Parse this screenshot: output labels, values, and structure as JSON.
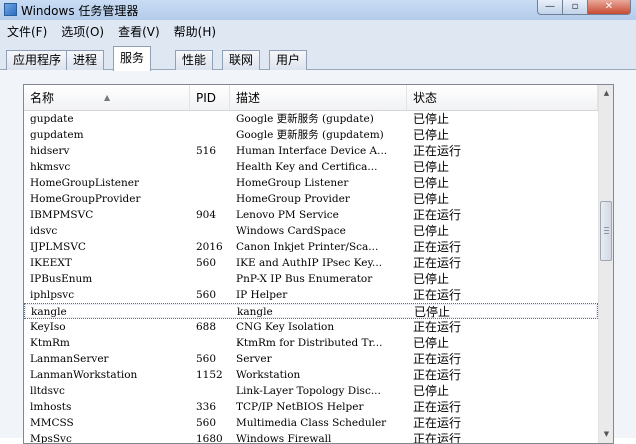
{
  "window": {
    "title": "Windows 任务管理器",
    "controls": {
      "minimize": "—",
      "maximize": "▫",
      "close": "✕"
    }
  },
  "menu": [
    "文件(F)",
    "选项(O)",
    "查看(V)",
    "帮助(H)"
  ],
  "tabs": [
    {
      "label": "应用程序",
      "active": false
    },
    {
      "label": "进程",
      "active": false
    },
    {
      "label": "服务",
      "active": true
    },
    {
      "label": "性能",
      "active": false
    },
    {
      "label": "联网",
      "active": false
    },
    {
      "label": "用户",
      "active": false
    }
  ],
  "services": {
    "columns": {
      "name": "名称",
      "pid": "PID",
      "desc": "描述",
      "status": "状态"
    },
    "sort": {
      "column": "name",
      "direction": "ascending"
    },
    "rows": [
      {
        "name": "gupdate",
        "pid": "",
        "desc": "Google 更新服务 (gupdate)",
        "status": "已停止",
        "selected": false
      },
      {
        "name": "gupdatem",
        "pid": "",
        "desc": "Google 更新服务 (gupdatem)",
        "status": "已停止",
        "selected": false
      },
      {
        "name": "hidserv",
        "pid": "516",
        "desc": "Human Interface Device A...",
        "status": "正在运行",
        "selected": false
      },
      {
        "name": "hkmsvc",
        "pid": "",
        "desc": "Health Key and Certifica...",
        "status": "已停止",
        "selected": false
      },
      {
        "name": "HomeGroupListener",
        "pid": "",
        "desc": "HomeGroup Listener",
        "status": "已停止",
        "selected": false
      },
      {
        "name": "HomeGroupProvider",
        "pid": "",
        "desc": "HomeGroup Provider",
        "status": "已停止",
        "selected": false
      },
      {
        "name": "IBMPMSVC",
        "pid": "904",
        "desc": "Lenovo PM Service",
        "status": "正在运行",
        "selected": false
      },
      {
        "name": "idsvc",
        "pid": "",
        "desc": "Windows CardSpace",
        "status": "已停止",
        "selected": false
      },
      {
        "name": "IJPLMSVC",
        "pid": "2016",
        "desc": "Canon Inkjet Printer/Sca...",
        "status": "正在运行",
        "selected": false
      },
      {
        "name": "IKEEXT",
        "pid": "560",
        "desc": "IKE and AuthIP IPsec Key...",
        "status": "正在运行",
        "selected": false
      },
      {
        "name": "IPBusEnum",
        "pid": "",
        "desc": "PnP-X IP Bus Enumerator",
        "status": "已停止",
        "selected": false
      },
      {
        "name": "iphlpsvc",
        "pid": "560",
        "desc": "IP Helper",
        "status": "正在运行",
        "selected": false
      },
      {
        "name": "kangle",
        "pid": "",
        "desc": "kangle",
        "status": "已停止",
        "selected": true
      },
      {
        "name": "KeyIso",
        "pid": "688",
        "desc": "CNG Key Isolation",
        "status": "正在运行",
        "selected": false
      },
      {
        "name": "KtmRm",
        "pid": "",
        "desc": "KtmRm for Distributed Tr...",
        "status": "已停止",
        "selected": false
      },
      {
        "name": "LanmanServer",
        "pid": "560",
        "desc": "Server",
        "status": "正在运行",
        "selected": false
      },
      {
        "name": "LanmanWorkstation",
        "pid": "1152",
        "desc": "Workstation",
        "status": "正在运行",
        "selected": false
      },
      {
        "name": "lltdsvc",
        "pid": "",
        "desc": "Link-Layer Topology Disc...",
        "status": "已停止",
        "selected": false
      },
      {
        "name": "lmhosts",
        "pid": "336",
        "desc": "TCP/IP NetBIOS Helper",
        "status": "正在运行",
        "selected": false
      },
      {
        "name": "MMCSS",
        "pid": "560",
        "desc": "Multimedia Class Scheduler",
        "status": "正在运行",
        "selected": false
      },
      {
        "name": "MpsSvc",
        "pid": "1680",
        "desc": "Windows Firewall",
        "status": "正在运行",
        "selected": false
      }
    ]
  },
  "scrollbar": {
    "up": "▲",
    "down": "▼"
  }
}
